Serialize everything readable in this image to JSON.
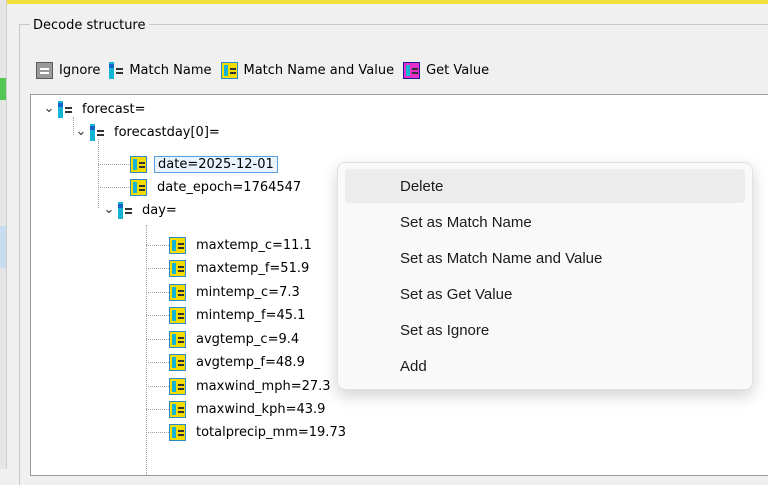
{
  "group": {
    "title": "Decode structure"
  },
  "legend": [
    {
      "label": "Ignore",
      "icon": "ignore-icon"
    },
    {
      "label": "Match Name",
      "icon": "match-name-icon"
    },
    {
      "label": "Match Name and Value",
      "icon": "match-name-value-icon"
    },
    {
      "label": "Get Value",
      "icon": "get-value-icon"
    }
  ],
  "tree": {
    "nodes": [
      {
        "label": "forecast=",
        "icon": "match-name-icon",
        "expanded": true
      },
      {
        "label": "forecastday[0]=",
        "icon": "match-name-icon",
        "expanded": true
      },
      {
        "label": "date=2025-12-01",
        "icon": "match-name-value-icon",
        "selected": true
      },
      {
        "label": "date_epoch=1764547",
        "icon": "match-name-value-icon"
      },
      {
        "label": "day=",
        "icon": "match-name-icon",
        "expanded": true
      },
      {
        "label": "maxtemp_c=11.1",
        "icon": "match-name-value-icon"
      },
      {
        "label": "maxtemp_f=51.9",
        "icon": "match-name-value-icon"
      },
      {
        "label": "mintemp_c=7.3",
        "icon": "match-name-value-icon"
      },
      {
        "label": "mintemp_f=45.1",
        "icon": "match-name-value-icon"
      },
      {
        "label": "avgtemp_c=9.4",
        "icon": "match-name-value-icon"
      },
      {
        "label": "avgtemp_f=48.9",
        "icon": "match-name-value-icon"
      },
      {
        "label": "maxwind_mph=27.3",
        "icon": "match-name-value-icon"
      },
      {
        "label": "maxwind_kph=43.9",
        "icon": "match-name-value-icon"
      },
      {
        "label": "totalprecip_mm=19.73",
        "icon": "match-name-value-icon"
      }
    ]
  },
  "context_menu": {
    "items": [
      {
        "label": "Delete",
        "highlighted": true
      },
      {
        "label": "Set as Match Name"
      },
      {
        "label": "Set as Match Name and Value"
      },
      {
        "label": "Set as Get Value"
      },
      {
        "label": "Set as Ignore"
      },
      {
        "label": "Add"
      }
    ]
  },
  "colors": {
    "accent_yellow": "#f3e03b",
    "selection_border": "#5aa0e6",
    "menu_hover": "#ececec"
  }
}
